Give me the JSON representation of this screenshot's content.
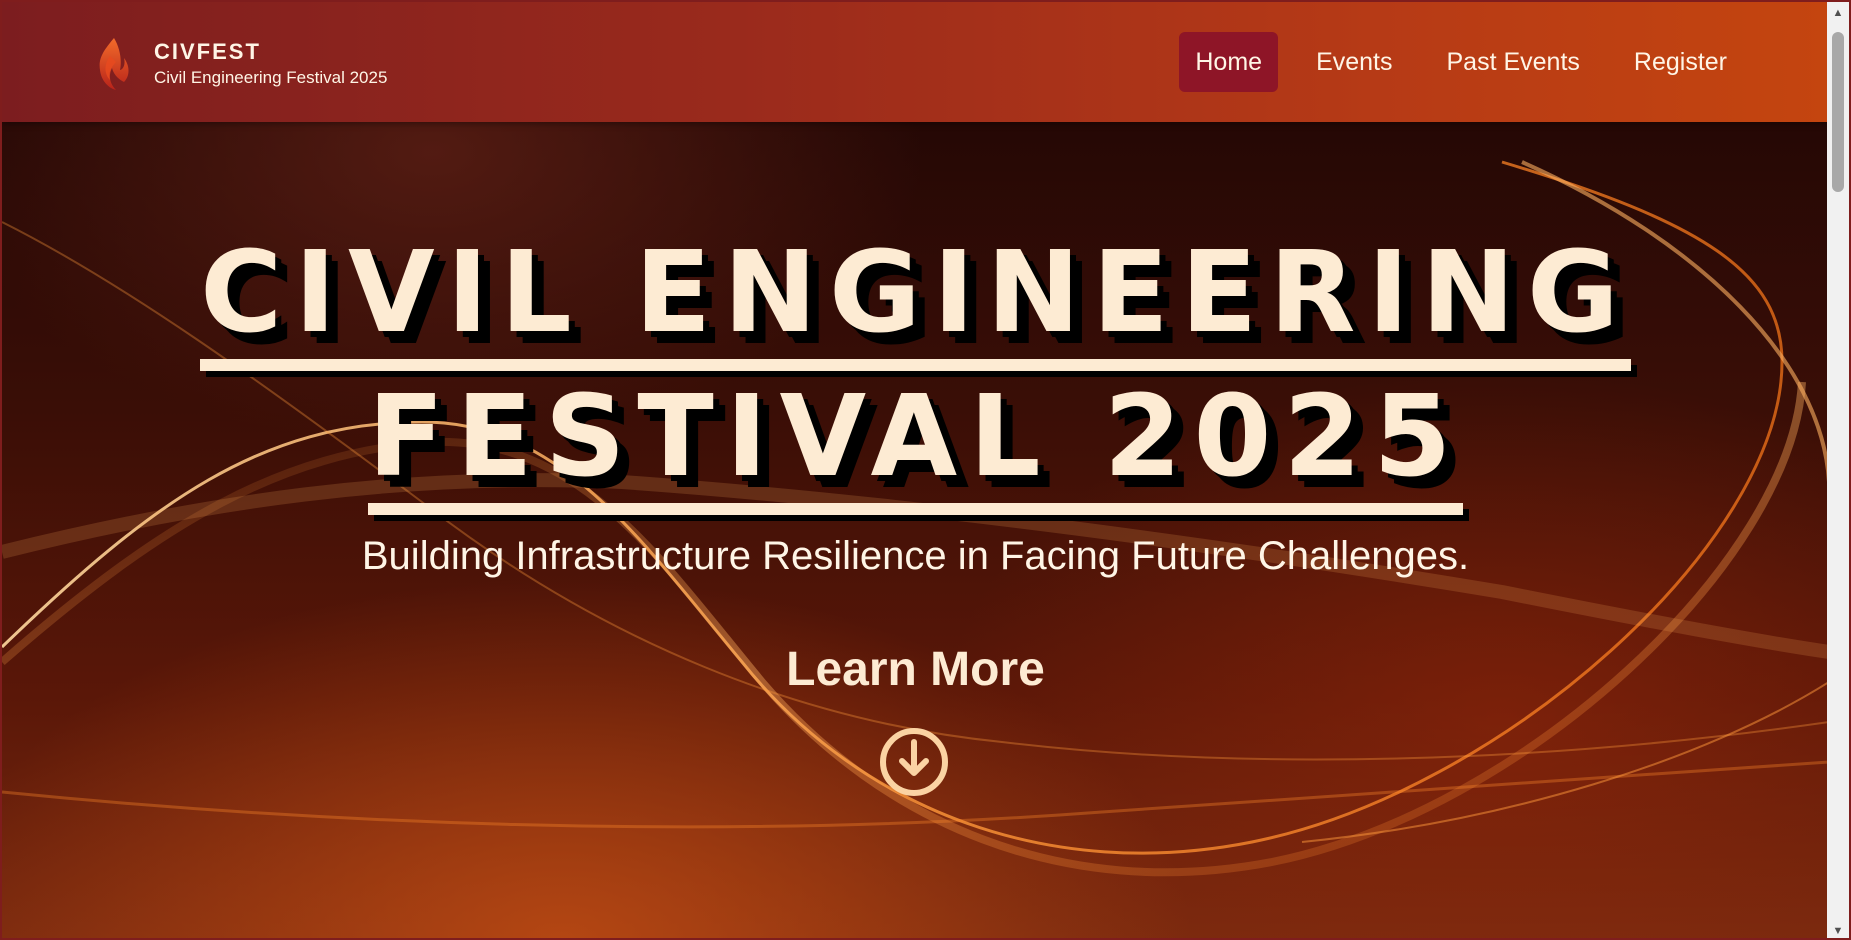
{
  "brand": {
    "name": "CIVFEST",
    "subtitle": "Civil Engineering Festival 2025",
    "logo_icon": "flame-logo-icon"
  },
  "nav": {
    "items": [
      {
        "label": "Home",
        "active": true
      },
      {
        "label": "Events",
        "active": false
      },
      {
        "label": "Past Events",
        "active": false
      },
      {
        "label": "Register",
        "active": false
      }
    ]
  },
  "hero": {
    "title_line1": "CIVIL ENGINEERING",
    "title_line2": "FESTIVAL 2025",
    "tagline": "Building Infrastructure Resilience in Facing Future Challenges.",
    "cta_label": "Learn More",
    "cta_icon": "arrow-down-circle-icon"
  },
  "colors": {
    "header_start": "#7c1d1f",
    "header_end": "#c4450f",
    "active_nav": "#8e1527",
    "title_text": "#fdebd3"
  }
}
